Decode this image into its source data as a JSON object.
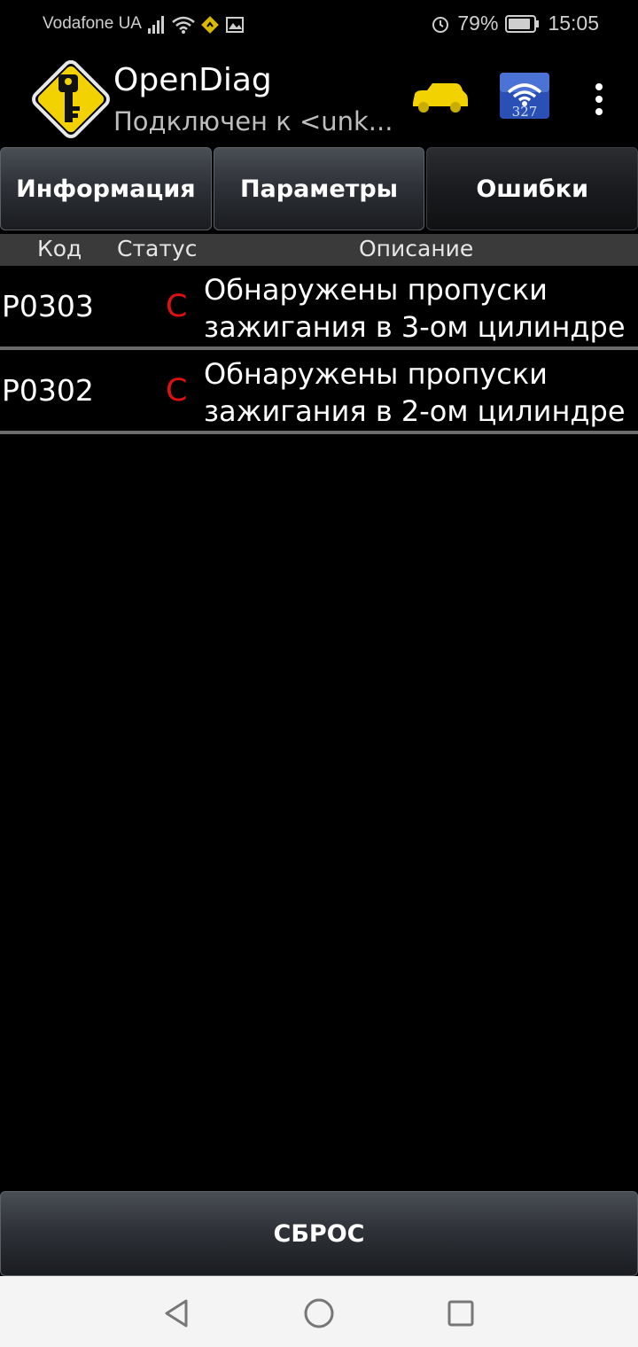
{
  "status_bar": {
    "carrier": "Vodafone UA",
    "battery": "79%",
    "time": "15:05",
    "icons": [
      "signal-icon",
      "wifi-icon",
      "nav-icon",
      "image-icon",
      "alarm-icon",
      "battery-icon"
    ]
  },
  "app_bar": {
    "title": "OpenDiag",
    "subtitle": "Подключен к <unk...",
    "icons": [
      "app-logo-key-icon",
      "car-icon",
      "elm327-wifi-icon",
      "overflow-menu-icon"
    ],
    "elm_label": "327",
    "colors": {
      "logo": "#f2d200",
      "car": "#f2d200",
      "elm": "#2a4fb5"
    }
  },
  "tabs": [
    {
      "label": "Информация",
      "active": false
    },
    {
      "label": "Параметры",
      "active": false
    },
    {
      "label": "Ошибки",
      "active": true
    }
  ],
  "table": {
    "headers": {
      "code": "Код",
      "status": "Статус",
      "description": "Описание"
    },
    "rows": [
      {
        "code": "P0303",
        "status": "C",
        "description": "Обнаружены пропуски зажигания в 3-ом цилиндре"
      },
      {
        "code": "P0302",
        "status": "C",
        "description": "Обнаружены пропуски зажигания в 2-ом цилиндре"
      }
    ],
    "status_color": "#e01010"
  },
  "actions": {
    "reset_label": "СБРОС"
  },
  "nav_bar": {
    "icons": [
      "back-icon",
      "home-icon",
      "recents-icon"
    ]
  }
}
